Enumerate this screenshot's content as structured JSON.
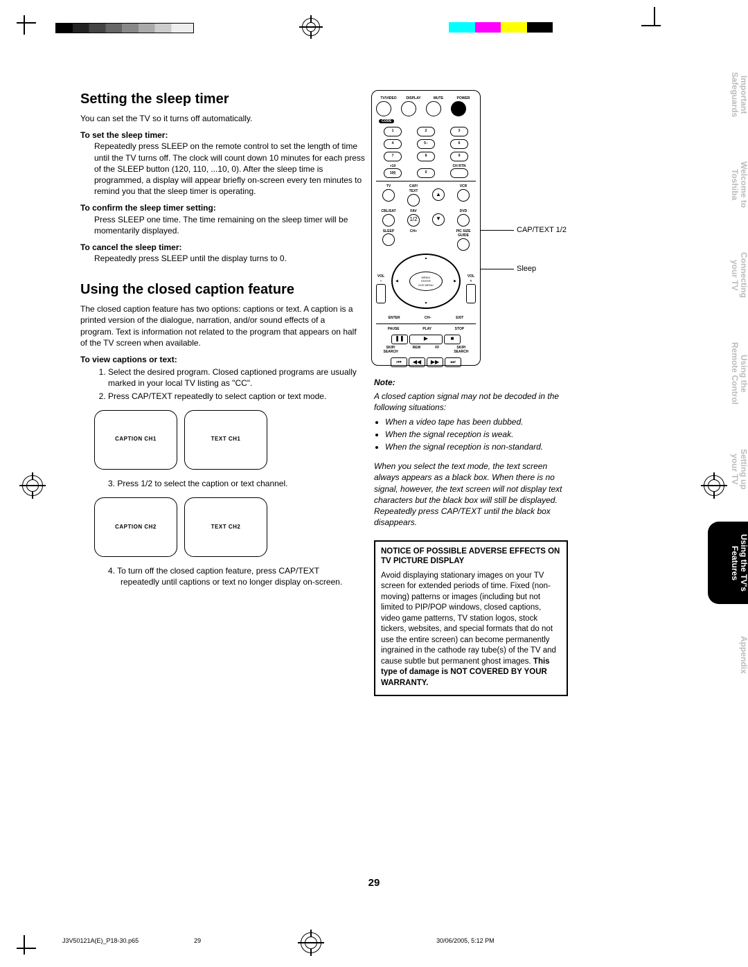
{
  "page_number": "29",
  "section1": {
    "heading": "Setting the sleep timer",
    "lead": "You can set the TV so it turns off automatically.",
    "sub1": "To set the sleep timer:",
    "body1": "Repeatedly press SLEEP on the remote control to set the length of time until the TV turns off. The clock will count down 10 minutes for each press of the SLEEP button (120, 110, ...10, 0). After the sleep time is programmed, a display will appear briefly on-screen every ten minutes to remind you that the sleep timer is operating.",
    "sub2": "To confirm the sleep timer setting:",
    "body2": "Press SLEEP one time. The time remaining on the sleep timer will be momentarily displayed.",
    "sub3": "To cancel the sleep timer:",
    "body3": "Repeatedly press SLEEP until the display turns to 0."
  },
  "section2": {
    "heading": "Using the closed caption feature",
    "lead": "The closed caption feature has two options: captions or text. A caption is a printed version of the dialogue, narration, and/or sound effects of a program. Text is information not related to the program that appears on half of the TV screen when available.",
    "sub1": "To view captions or text:",
    "step1": "Select the desired program. Closed captioned programs are usually marked in your local TV listing as \"CC\".",
    "step2": "Press CAP/TEXT repeatedly to select caption or text mode.",
    "screen1a": "CAPTION CH1",
    "screen1b": "TEXT CH1",
    "step3": "Press 1/2 to select the caption or text channel.",
    "screen2a": "CAPTION CH2",
    "screen2b": "TEXT CH2",
    "step4": "To turn off the closed caption feature, press CAP/TEXT repeatedly until captions or text no longer display on-screen."
  },
  "callouts": {
    "captext": "CAP/TEXT 1/2",
    "sleep": "Sleep"
  },
  "note": {
    "head": "Note:",
    "intro": "A closed caption signal may not be decoded in the following situations:",
    "items": [
      "When a video tape has been dubbed.",
      "When the signal reception is weak.",
      "When the signal reception is non-standard."
    ],
    "para": "When you select the text mode, the text screen always appears as a black box. When there is no signal, however, the text screen will not display text characters but the black box will still be displayed. Repeatedly press CAP/TEXT until the black box disappears."
  },
  "warning": {
    "title": "NOTICE OF POSSIBLE ADVERSE EFFECTS ON TV PICTURE DISPLAY",
    "body_a": "Avoid displaying stationary images on your TV screen for extended periods of time. Fixed (non-moving) patterns or images (including but not limited to PIP/POP windows, closed captions, video game patterns, TV station logos, stock tickers, websites, and special formats that do not use the entire screen) can become permanently ingrained in the cathode ray tube(s) of the TV and cause subtle but permanent ghost images. ",
    "body_bold": "This type of damage is NOT COVERED BY YOUR WARRANTY."
  },
  "footer": {
    "file": "J3V50121A(E)_P18-30.p65",
    "pg": "29",
    "date": "30/06/2005, 5:12 PM"
  },
  "tabs": [
    {
      "l1": "Important",
      "l2": "Safeguards",
      "active": false
    },
    {
      "l1": "Welcome to",
      "l2": "Toshiba",
      "active": false
    },
    {
      "l1": "Connecting",
      "l2": "your TV",
      "active": false
    },
    {
      "l1": "Using the",
      "l2": "Remote Control",
      "active": false
    },
    {
      "l1": "Setting up",
      "l2": "your TV",
      "active": false
    },
    {
      "l1": "Using the TV's",
      "l2": "Features",
      "active": true
    },
    {
      "l1": "Appendix",
      "l2": "",
      "active": false
    }
  ],
  "remote": {
    "toprow": [
      "TV/VIDEO",
      "DISPLAY",
      "MUTE",
      "POWER"
    ],
    "code": "CODE",
    "num": [
      "1",
      "2",
      "3",
      "4",
      "5",
      "6",
      "7",
      "8",
      "9",
      "10̲0̲",
      "0"
    ],
    "plusten": "+10",
    "chrt": "CH RTN",
    "tv": "TV",
    "vcr": "VCR",
    "captext": "CAP/\nTEXT",
    "cbl": "CBL/SAT",
    "fav": "FAV",
    "dvd": "DVD",
    "half": "1/2",
    "sleep": "SLEEP",
    "chp": "CH+",
    "psg": "PIC SIZE\nGUIDE",
    "volm": "VOL\n–",
    "volp": "VOL\n+",
    "menu": "MENU/\nENTER\nDVD MENU",
    "enter": "ENTER",
    "chm": "CH–",
    "exit": "EXIT",
    "pause": "PAUSE",
    "play": "PLAY",
    "stop": "STOP",
    "skipb": "SKIP/\nSEARCH",
    "rew": "REW",
    "ff": "FF",
    "skipf": "SKIP/\nSEARCH"
  }
}
